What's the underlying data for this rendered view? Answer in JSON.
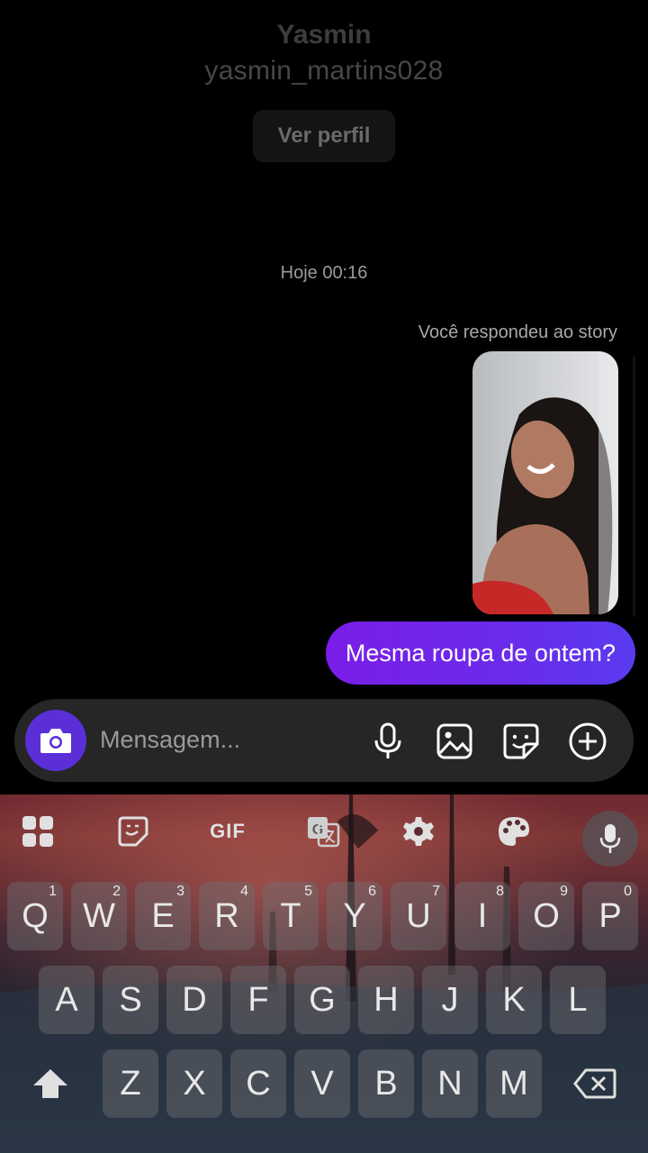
{
  "profile": {
    "name": "Yasmin",
    "username": "yasmin_martins028",
    "view_profile_label": "Ver perfil"
  },
  "chat": {
    "timestamp": "Hoje 00:16",
    "story_reply_label": "Você respondeu ao story",
    "message": "Mesma roupa de ontem?"
  },
  "composer": {
    "placeholder": "Mensagem...",
    "icons": [
      "camera-icon",
      "microphone-icon",
      "gallery-icon",
      "sticker-icon",
      "add-icon"
    ]
  },
  "keyboard": {
    "toolbar": {
      "gif_label": "GIF"
    },
    "row1": [
      {
        "key": "Q",
        "num": "1"
      },
      {
        "key": "W",
        "num": "2"
      },
      {
        "key": "E",
        "num": "3"
      },
      {
        "key": "R",
        "num": "4"
      },
      {
        "key": "T",
        "num": "5"
      },
      {
        "key": "Y",
        "num": "6"
      },
      {
        "key": "U",
        "num": "7"
      },
      {
        "key": "I",
        "num": "8"
      },
      {
        "key": "O",
        "num": "9"
      },
      {
        "key": "P",
        "num": "0"
      }
    ],
    "row2": [
      "A",
      "S",
      "D",
      "F",
      "G",
      "H",
      "J",
      "K",
      "L"
    ],
    "row3": [
      "Z",
      "X",
      "C",
      "V",
      "B",
      "N",
      "M"
    ]
  },
  "colors": {
    "bubble_gradient_start": "#7a1de8",
    "bubble_gradient_end": "#5a3bf0",
    "camera_button": "#5b2fd8",
    "composer_bg": "#262626"
  }
}
